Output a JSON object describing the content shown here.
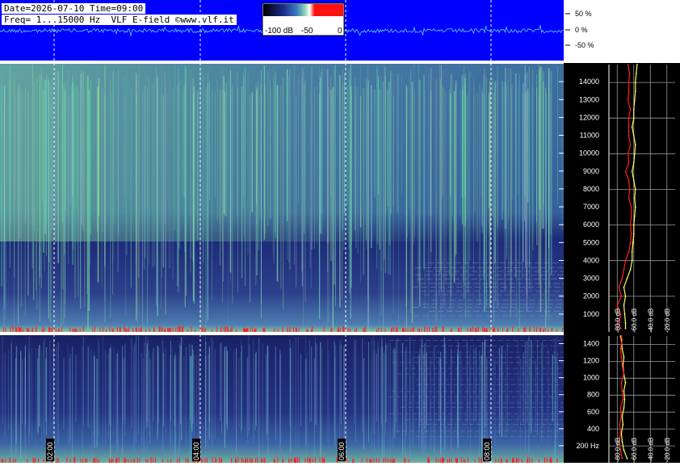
{
  "header": {
    "line1": "Date=2026-07-10 Time=09:00",
    "line2": "Freq= 1...15000 Hz  VLF E-field ©www.vlf.it"
  },
  "colors": {
    "waveform_bg": "#0000ff",
    "panel_bg": "#14194a",
    "grid": "#ffffff",
    "trace": "#5fd7e8",
    "spectrum_red": "#ff2020",
    "spectrum_yellow": "#ffff60"
  },
  "colorbar": {
    "labels": [
      "-100 dB",
      "-50",
      "0"
    ],
    "stops": [
      "#000000",
      "#1c2a8a",
      "#3a7ec0",
      "#8fd3b0",
      "#ffffff",
      "#ff1010",
      "#ff1010"
    ]
  },
  "amplitude_scale": {
    "labels": [
      "50 %",
      "0 %",
      "-50 %"
    ]
  },
  "chart_data": [
    {
      "type": "heatmap",
      "name": "upper-spectrogram",
      "ylabel": "",
      "ylim": [
        0,
        15000
      ],
      "y_ticks": [
        "14000",
        "13000",
        "12000",
        "11000",
        "10000",
        "9000",
        "8000",
        "7000",
        "6000",
        "5000",
        "4000",
        "3000",
        "2000",
        "1000"
      ],
      "colorbar_range_db": [
        -100,
        0
      ]
    },
    {
      "type": "heatmap",
      "name": "lower-spectrogram",
      "ylim": [
        0,
        1500
      ],
      "y_ticks": [
        "1400",
        "1200",
        "1000",
        "800",
        "600",
        "400",
        "200 Hz"
      ],
      "x_time_labels": [
        "02:00",
        "04:00",
        "06:00",
        "08:00"
      ]
    },
    {
      "type": "line",
      "name": "average-spectrum",
      "x_ticks": [
        "-80.0 dB",
        "-60.0 dB",
        "-40.0 dB",
        "-20.0 dB"
      ],
      "xlim": [
        -90,
        -10
      ],
      "ylim": [
        0,
        15000
      ],
      "series": [
        {
          "color": "#ffff60",
          "x": [
            -70,
            -70,
            -71,
            -72,
            -70,
            -72,
            -68,
            -64,
            -62,
            -62,
            -61,
            -60,
            -60,
            -59,
            -58,
            -59,
            -58,
            -60,
            -62,
            -60,
            -59,
            -58,
            -60,
            -62,
            -60,
            -60,
            -59,
            -58,
            -58,
            -57,
            -56
          ],
          "y": [
            200,
            500,
            1000,
            1500,
            2000,
            2500,
            3000,
            3500,
            4000,
            4500,
            5000,
            5500,
            6000,
            6500,
            7000,
            7500,
            8000,
            8500,
            9000,
            9500,
            10000,
            10500,
            11000,
            11500,
            12000,
            12500,
            13000,
            13500,
            14000,
            14500,
            15000
          ]
        },
        {
          "color": "#ff2020",
          "x": [
            -76,
            -78,
            -76,
            -80,
            -75,
            -78,
            -74,
            -72,
            -70,
            -66,
            -64,
            -63,
            -64,
            -63,
            -63,
            -66,
            -65,
            -66,
            -70,
            -66,
            -67,
            -64,
            -66,
            -66,
            -66,
            -64,
            -67,
            -66,
            -66,
            -65,
            -67
          ],
          "y": [
            200,
            500,
            1000,
            1500,
            2000,
            2500,
            3000,
            3500,
            4000,
            4500,
            5000,
            5500,
            6000,
            6500,
            7000,
            7500,
            8000,
            8500,
            9000,
            9500,
            10000,
            10500,
            11000,
            11500,
            12000,
            12500,
            13000,
            13500,
            14000,
            14500,
            15000
          ]
        }
      ]
    },
    {
      "type": "line",
      "name": "average-spectrum-low",
      "x_ticks": [
        "-80.0 dB",
        "-60.0 dB",
        "-40.0 dB",
        "-20.0 dB"
      ],
      "xlim": [
        -90,
        -10
      ],
      "ylim": [
        0,
        1500
      ],
      "series": [
        {
          "color": "#ffff60",
          "x": [
            -68,
            -72,
            -74,
            -75,
            -73,
            -74,
            -72,
            -71,
            -72,
            -70,
            -72,
            -73,
            -72,
            -74,
            -75,
            -76
          ],
          "y": [
            50,
            150,
            250,
            350,
            450,
            550,
            650,
            750,
            850,
            950,
            1050,
            1150,
            1250,
            1350,
            1450,
            1500
          ]
        },
        {
          "color": "#ff2020",
          "x": [
            -74,
            -76,
            -78,
            -76,
            -77,
            -75,
            -76,
            -73,
            -74,
            -75,
            -72,
            -74,
            -75,
            -76,
            -74,
            -75
          ],
          "y": [
            50,
            150,
            250,
            350,
            450,
            550,
            650,
            750,
            850,
            950,
            1050,
            1150,
            1250,
            1350,
            1450,
            1500
          ]
        }
      ]
    }
  ]
}
